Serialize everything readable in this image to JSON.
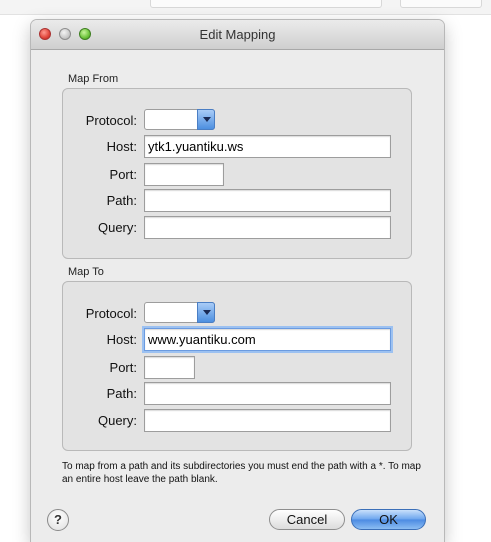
{
  "window": {
    "title": "Edit Mapping"
  },
  "map_from": {
    "section_label": "Map From",
    "protocol_label": "Protocol:",
    "protocol_value": "",
    "host_label": "Host:",
    "host_value": "ytk1.yuantiku.ws",
    "port_label": "Port:",
    "port_value": "",
    "path_label": "Path:",
    "path_value": "",
    "query_label": "Query:",
    "query_value": ""
  },
  "map_to": {
    "section_label": "Map To",
    "protocol_label": "Protocol:",
    "protocol_value": "",
    "host_label": "Host:",
    "host_value": "www.yuantiku.com",
    "port_label": "Port:",
    "port_value": "",
    "path_label": "Path:",
    "path_value": "",
    "query_label": "Query:",
    "query_value": ""
  },
  "note": "To map from a path and its subdirectories you must end the path with a *. To map an entire host leave the path blank.",
  "buttons": {
    "help": "?",
    "cancel": "Cancel",
    "ok": "OK"
  },
  "colors": {
    "window_bg": "#ececec",
    "group_bg": "#e3e3e3",
    "accent_blue": "#4b8ae2"
  }
}
